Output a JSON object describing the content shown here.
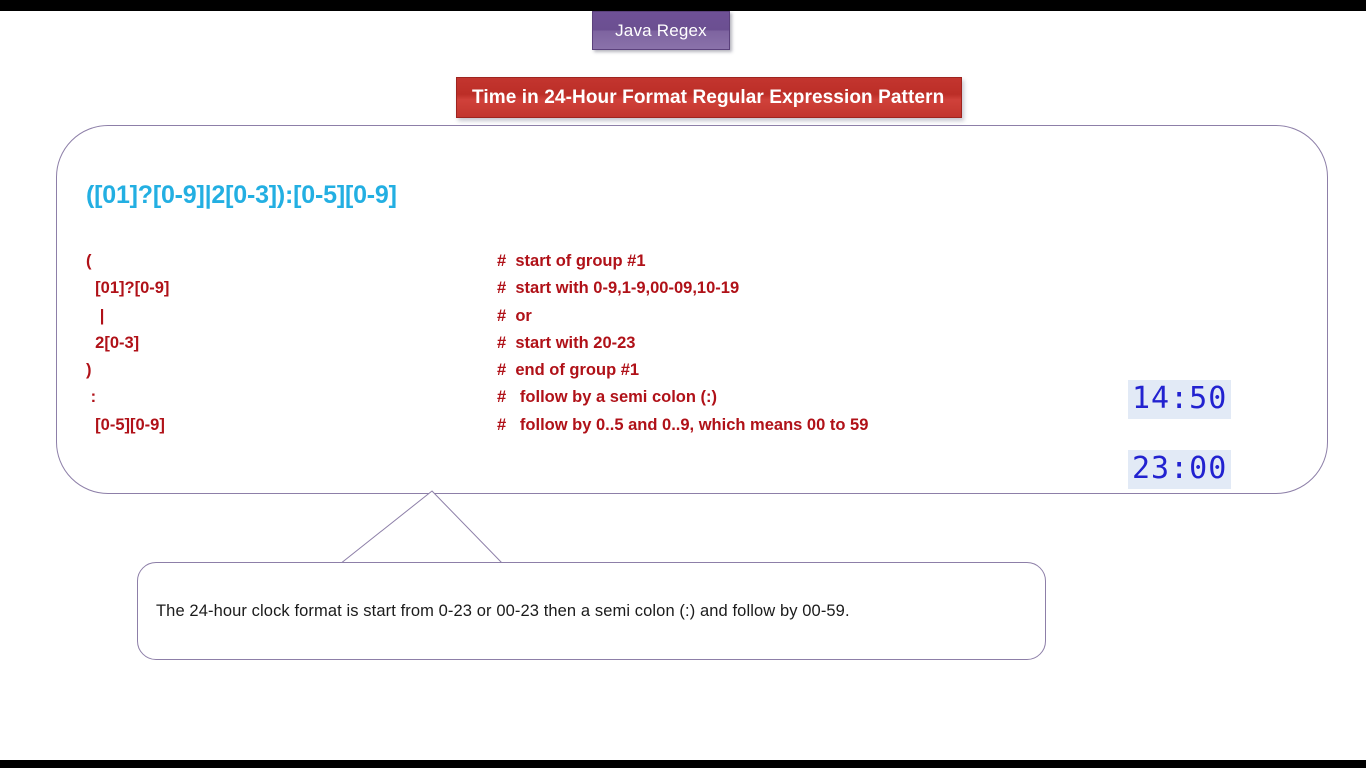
{
  "header": {
    "chip_label": "Java Regex",
    "banner_title": "Time in 24-Hour Format Regular Expression Pattern"
  },
  "panel": {
    "regex_pattern": "([01]?[0-9]|2[0-3]):[0-5][0-9]",
    "breakdown": [
      {
        "token": "(",
        "comment": "#  start of group #1"
      },
      {
        "token": "  [01]?[0-9]",
        "comment": "#  start with 0-9,1-9,00-09,10-19"
      },
      {
        "token": "   |",
        "comment": "#  or"
      },
      {
        "token": "  2[0-3]",
        "comment": "#  start with 20-23"
      },
      {
        "token": ")",
        "comment": "#  end of group #1"
      },
      {
        "token": " :",
        "comment": "#   follow by a semi colon (:)"
      },
      {
        "token": "  [0-5][0-9]",
        "comment": "#   follow by 0..5 and 0..9, which means 00 to 59"
      }
    ],
    "samples": [
      "14:50",
      "23:00"
    ]
  },
  "callout": {
    "text": "The 24-hour clock format is start from 0-23 or 00-23 then a semi colon (:) and follow by 00-59."
  },
  "colors": {
    "chip_purple": "#6b4f91",
    "banner_red": "#bc2e27",
    "regex_cyan": "#23afe2",
    "breakdown_red": "#b01118",
    "sample_blue": "#2222d0",
    "sample_highlight": "#e2eaf6",
    "outline_purple": "#8d7fa8",
    "letterbox_black": "#000000"
  }
}
